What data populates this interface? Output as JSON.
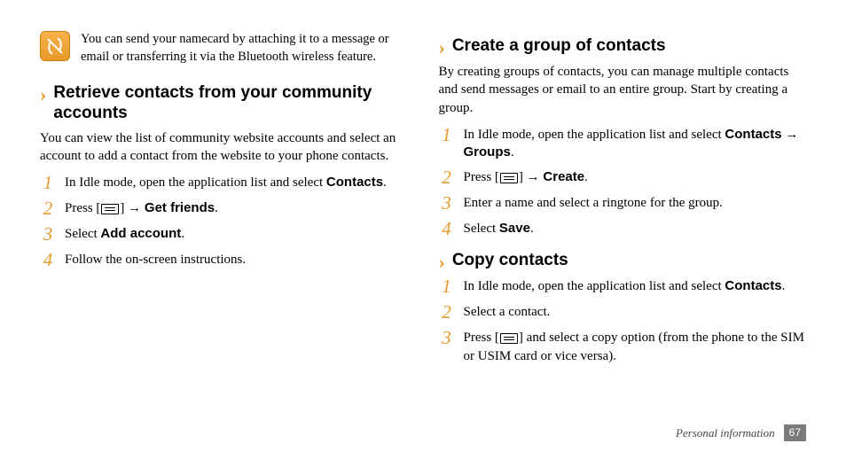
{
  "note": {
    "text": "You can send your namecard by attaching it to a message or email or transferring it via the Bluetooth wireless feature."
  },
  "left": {
    "heading": "Retrieve contacts from your community accounts",
    "desc": "You can view the list of community website accounts and select an account to add a contact from the website to your phone contacts.",
    "steps": [
      {
        "num": "1",
        "parts": [
          "In Idle mode, open the application list and select ",
          "Contacts",
          "."
        ]
      },
      {
        "num": "2",
        "parts": [
          "Press [",
          "MENU",
          "] → ",
          "Get friends",
          "."
        ]
      },
      {
        "num": "3",
        "parts": [
          "Select ",
          "Add account",
          "."
        ]
      },
      {
        "num": "4",
        "parts": [
          "Follow the on-screen instructions."
        ]
      }
    ]
  },
  "right": {
    "section1": {
      "heading": "Create a group of contacts",
      "desc": "By creating groups of contacts, you can manage multiple contacts and send messages or email to an entire group. Start by creating a group.",
      "steps": [
        {
          "num": "1",
          "parts": [
            "In Idle mode, open the application list and select ",
            "Contacts",
            " → ",
            "Groups",
            "."
          ]
        },
        {
          "num": "2",
          "parts": [
            "Press [",
            "MENU",
            "] → ",
            "Create",
            "."
          ]
        },
        {
          "num": "3",
          "parts": [
            "Enter a name and select a ringtone for the group."
          ]
        },
        {
          "num": "4",
          "parts": [
            "Select ",
            "Save",
            "."
          ]
        }
      ]
    },
    "section2": {
      "heading": "Copy contacts",
      "steps": [
        {
          "num": "1",
          "parts": [
            "In Idle mode, open the application list and select ",
            "Contacts",
            "."
          ]
        },
        {
          "num": "2",
          "parts": [
            "Select a contact."
          ]
        },
        {
          "num": "3",
          "parts": [
            "Press [",
            "MENU",
            "] and select a copy option (from the phone to the SIM or USIM card or vice versa)."
          ]
        }
      ]
    }
  },
  "footer": {
    "section": "Personal information",
    "page": "67"
  }
}
